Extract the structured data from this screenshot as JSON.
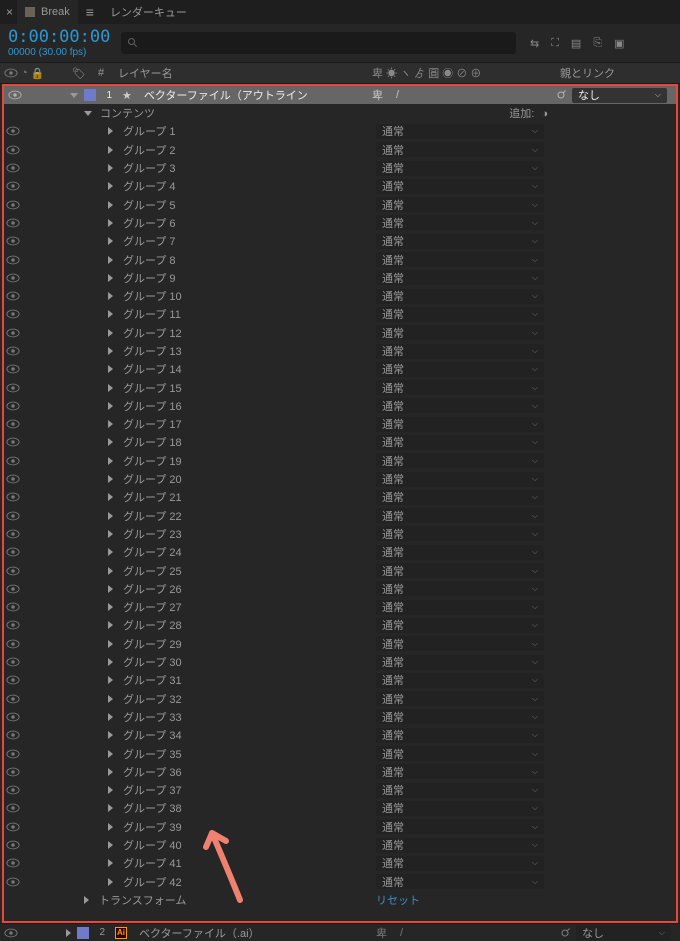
{
  "tabs": {
    "active": "Break",
    "render_queue": "レンダーキュー"
  },
  "timecode": "0:00:00:00",
  "frame_fps": "00000 (30.00 fps)",
  "headers": {
    "hash": "#",
    "layer_name": "レイヤー名",
    "switches": "卑 ☀ ヽ ゟ 圓 ◉ ⊘ ⊕",
    "parent_link": "親とリンク"
  },
  "layer1": {
    "num": "1",
    "name": "ベクターファイル（アウトライン",
    "parent": "なし"
  },
  "contents": {
    "label": "コンテンツ",
    "add_label": "追加:"
  },
  "group_prefix": "グループ",
  "mode_normal": "通常",
  "groups": [
    1,
    2,
    3,
    4,
    5,
    6,
    7,
    8,
    9,
    10,
    11,
    12,
    13,
    14,
    15,
    16,
    17,
    18,
    19,
    20,
    21,
    22,
    23,
    24,
    25,
    26,
    27,
    28,
    29,
    30,
    31,
    32,
    33,
    34,
    35,
    36,
    37,
    38,
    39,
    40,
    41,
    42
  ],
  "transform": {
    "label": "トランスフォーム",
    "reset": "リセット"
  },
  "layer2": {
    "num": "2",
    "name": "ベクターファイル（.ai）",
    "parent": "なし"
  }
}
